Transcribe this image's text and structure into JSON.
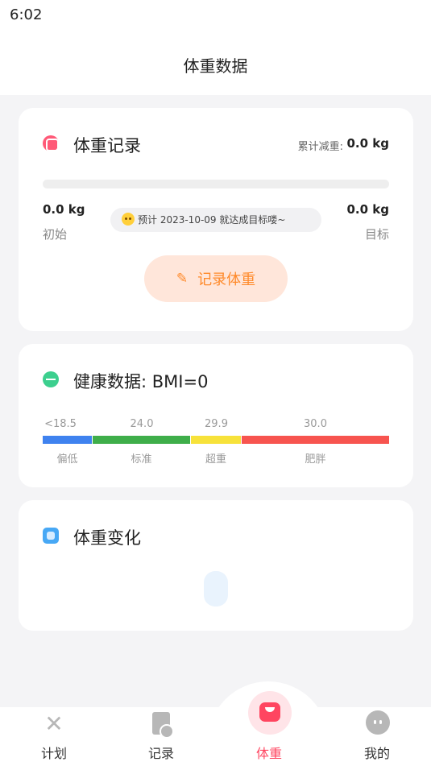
{
  "status_bar": {
    "time": "6:02"
  },
  "header": {
    "title": "体重数据"
  },
  "weight_card": {
    "title": "体重记录",
    "cumulative_label": "累计减重:",
    "cumulative_value": "0.0 kg",
    "progress": 0,
    "start_value": "0.0 kg",
    "start_label": "初始",
    "goal_value": "0.0 kg",
    "goal_label": "目标",
    "estimate_text": "预计 2023-10-09 就达成目标喽~",
    "record_button": "记录体重",
    "accent_color": "#ff8a2a"
  },
  "health_card": {
    "title": "健康数据: BMI=0",
    "ticks": [
      "<18.5",
      "24.0",
      "29.9",
      "30.0"
    ],
    "categories": [
      "偏低",
      "标准",
      "超重",
      "肥胖"
    ],
    "colors": [
      "#3f82ef",
      "#3fae4a",
      "#f7e23a",
      "#f7544f"
    ]
  },
  "trend_card": {
    "title": "体重变化"
  },
  "bottom_nav": {
    "items": [
      {
        "label": "计划",
        "icon": "fork-knife-icon"
      },
      {
        "label": "记录",
        "icon": "record-doc-icon"
      },
      {
        "label": "体重",
        "icon": "scale-icon",
        "active": true
      },
      {
        "label": "我的",
        "icon": "profile-chat-icon"
      }
    ],
    "active_color": "#ff4560"
  }
}
